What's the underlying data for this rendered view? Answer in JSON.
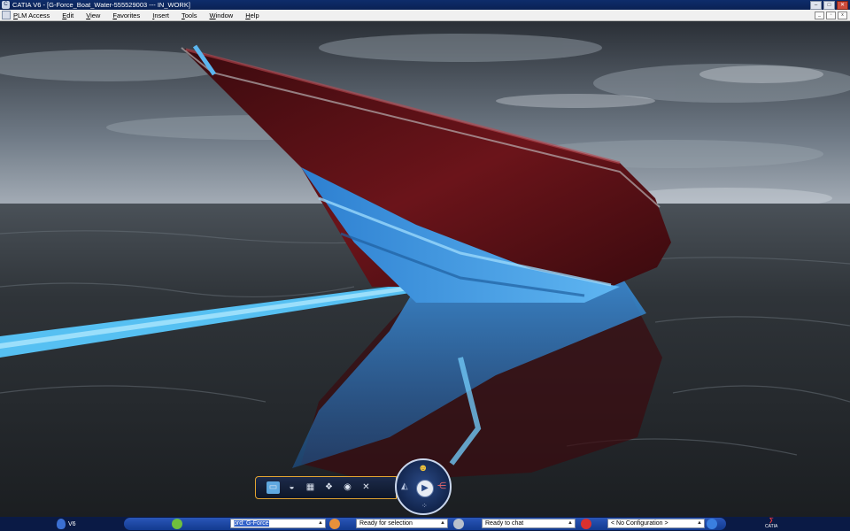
{
  "titlebar": {
    "title": "CATIA V6 - [G-Force_Boat_Water-555529003 --- IN_WORK]"
  },
  "menubar": {
    "items": [
      "PLM Access",
      "Edit",
      "View",
      "Favorites",
      "Insert",
      "Tools",
      "Window",
      "Help"
    ]
  },
  "statusbar": {
    "app_label": "V6",
    "search_value": "prd: G-Force",
    "selection_status": "Ready for selection",
    "chat_status": "Ready to chat",
    "configuration": "< No Configuration >",
    "brand": "CATIA"
  },
  "icons": {
    "actionbar": [
      "sheet-icon",
      "shading-icon",
      "multi-view-icon",
      "render-icon",
      "camera-icon",
      "tools-icon"
    ],
    "wheel": [
      "people-icon",
      "play-icon",
      "tree-icon",
      "compass-icon"
    ]
  },
  "colors": {
    "accent": "#e2a431",
    "statusbar": "#0a1a45",
    "hull_red": "#5a0f14",
    "hull_blue": "#3a8fd9"
  }
}
